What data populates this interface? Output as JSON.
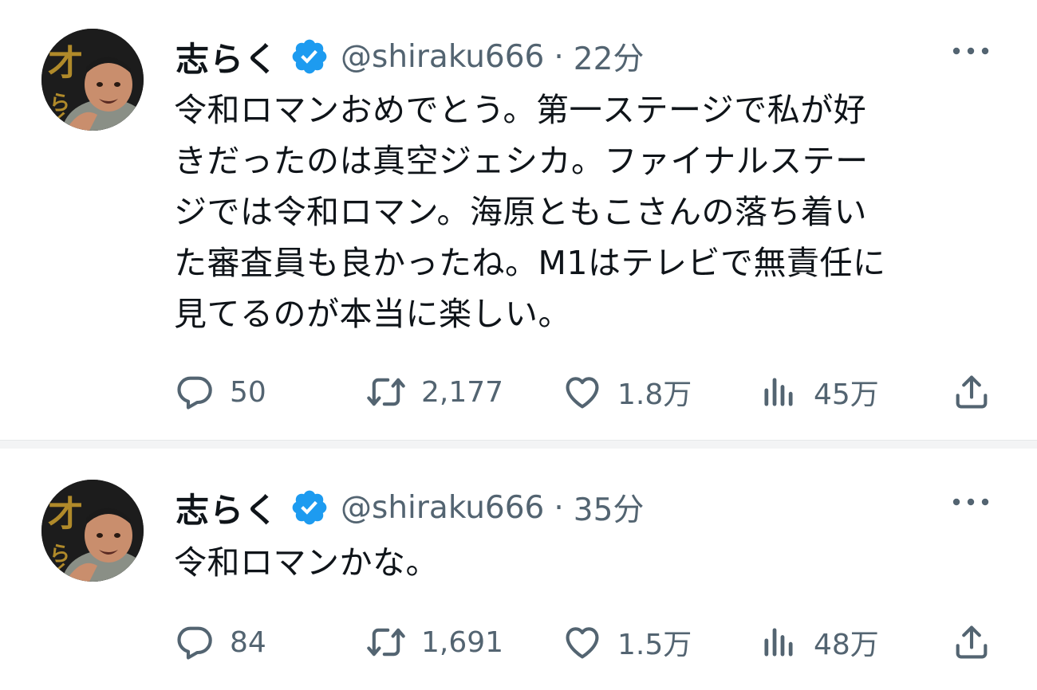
{
  "tweets": [
    {
      "display_name": "志らく",
      "handle": "@shiraku666",
      "separator": "·",
      "time": "22分",
      "text": "令和ロマンおめでとう。第一ステージで私が好きだったのは真空ジェシカ。ファイナルステージでは令和ロマン。海原ともこさんの落ち着いた審査員も良かったね。M1はテレビで無責任に見てるのが本当に楽しい。",
      "text_lines": [
        "令和ロマンおめでとう。第一ステージで私が好",
        "きだったのは真空ジェシカ。ファイナルステー",
        "ジでは令和ロマン。海原ともこさんの落ち着い",
        "た審査員も良かったね。M1はテレビで無責任に",
        "見てるのが本当に楽しい。"
      ],
      "replies": "50",
      "retweets": "2,177",
      "likes": "1.8万",
      "views": "45万",
      "avatar_text": "才らく"
    },
    {
      "display_name": "志らく",
      "handle": "@shiraku666",
      "separator": "·",
      "time": "35分",
      "text": "令和ロマンかな。",
      "text_lines": [
        "令和ロマンかな。"
      ],
      "replies": "84",
      "retweets": "1,691",
      "likes": "1.5万",
      "views": "48万",
      "avatar_text": "才らく"
    }
  ],
  "icons": {
    "verified": "verified-badge-icon",
    "more": "more-dots-icon",
    "reply": "reply-bubble-icon",
    "retweet": "retweet-arrows-icon",
    "like": "heart-icon",
    "views": "bar-chart-icon",
    "share": "share-upload-icon"
  },
  "colors": {
    "text": "#0f1419",
    "secondary": "#536471",
    "verified": "#1d9bf0",
    "divider": "#f3f4f5"
  }
}
